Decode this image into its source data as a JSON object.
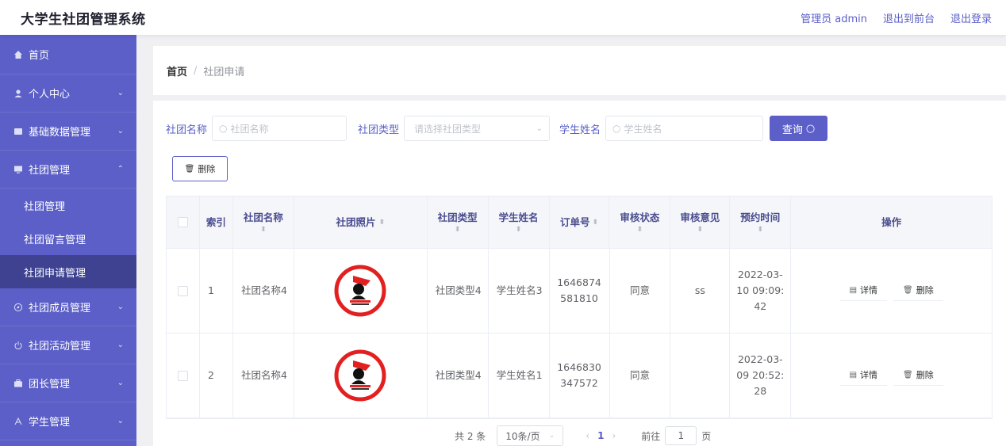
{
  "app": {
    "title": "大学生社团管理系统"
  },
  "header": {
    "user": "管理员 admin",
    "front": "退出到前台",
    "logout": "退出登录"
  },
  "sidebar": {
    "items": [
      {
        "label": "首页",
        "icon": "home-icon",
        "chevron": ""
      },
      {
        "label": "个人中心",
        "icon": "user-icon",
        "chevron": "⌄"
      },
      {
        "label": "基础数据管理",
        "icon": "data-icon",
        "chevron": "⌄"
      },
      {
        "label": "社团管理",
        "icon": "monitor-icon",
        "chevron": "⌃"
      },
      {
        "label": "社团成员管理",
        "icon": "compass-icon",
        "chevron": "⌄"
      },
      {
        "label": "社团活动管理",
        "icon": "power-icon",
        "chevron": "⌄"
      },
      {
        "label": "团长管理",
        "icon": "briefcase-icon",
        "chevron": "⌄"
      },
      {
        "label": "学生管理",
        "icon": "student-icon",
        "chevron": "⌄"
      }
    ],
    "sub": [
      "社团管理",
      "社团留言管理",
      "社团申请管理"
    ]
  },
  "breadcrumb": {
    "home": "首页",
    "sep": "/",
    "current": "社团申请"
  },
  "search": {
    "club_label": "社团名称",
    "club_placeholder": "社团名称",
    "type_label": "社团类型",
    "type_placeholder": "请选择社团类型",
    "student_label": "学生姓名",
    "student_placeholder": "学生姓名",
    "query": "查询"
  },
  "toolbar": {
    "delete": "删除"
  },
  "table": {
    "headers": {
      "index": "索引",
      "name": "社团名称",
      "photo": "社团照片",
      "type": "社团类型",
      "student": "学生姓名",
      "order": "订单号",
      "status": "审核状态",
      "opinion": "审核意见",
      "time": "预约时间",
      "ops": "操作"
    },
    "rows": [
      {
        "index": "1",
        "name": "社团名称4",
        "type": "社团类型4",
        "student": "学生姓名3",
        "order": "1646874581810",
        "status": "同意",
        "opinion": "ss",
        "time": "2022-03-10 09:09:42"
      },
      {
        "index": "2",
        "name": "社团名称4",
        "type": "社团类型4",
        "student": "学生姓名1",
        "order": "1646830347572",
        "status": "同意",
        "opinion": "",
        "time": "2022-03-09 20:52:28"
      }
    ],
    "op_detail": "详情",
    "op_delete": "删除"
  },
  "pagination": {
    "total": "共 2 条",
    "size": "10条/页",
    "page": "1",
    "goto": "前往",
    "goto_value": "1",
    "goto_unit": "页"
  },
  "colors": {
    "accent": "#5b5fc7",
    "active_sub": "#3e4290"
  }
}
